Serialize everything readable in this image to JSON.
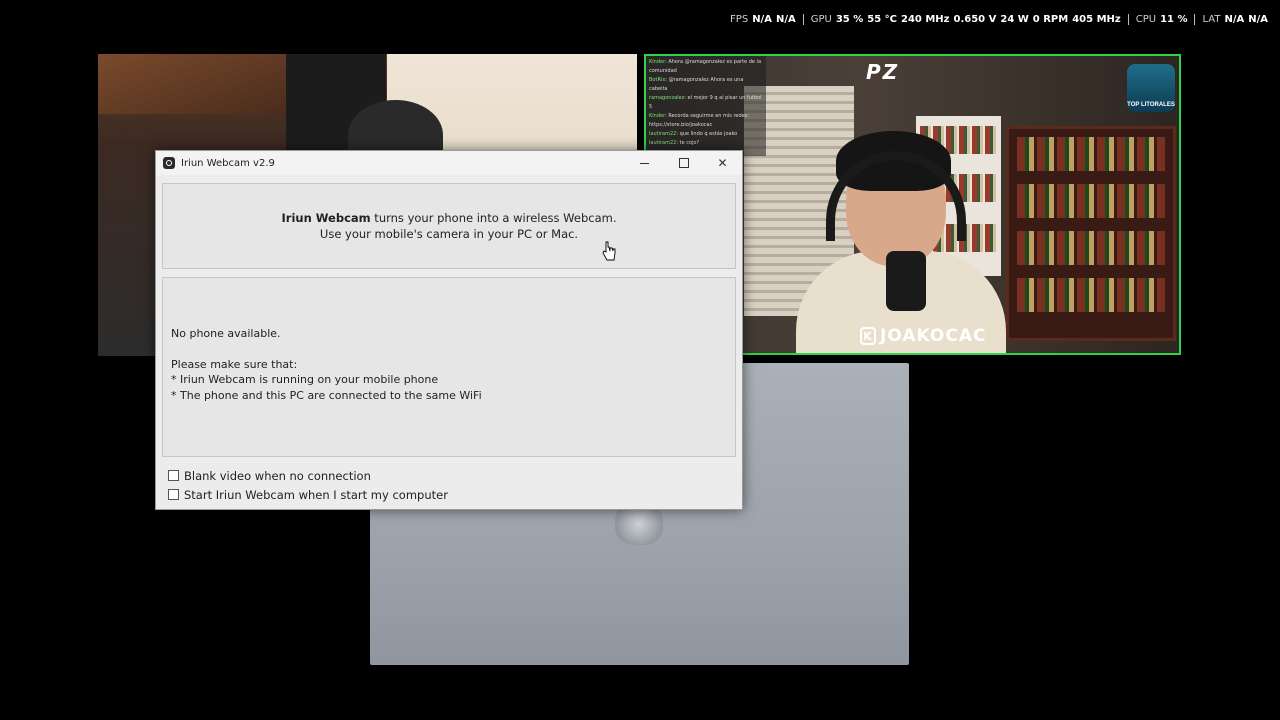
{
  "perf_overlay": [
    {
      "label": "FPS",
      "values": [
        "N/A",
        "N/A"
      ]
    },
    {
      "label": "GPU",
      "values": [
        "35 %",
        "55 °C",
        "240 MHz",
        "0.650 V",
        "24 W",
        "0 RPM",
        "405 MHz"
      ]
    },
    {
      "label": "CPU",
      "values": [
        "11 %"
      ]
    },
    {
      "label": "LAT",
      "values": [
        "N/A",
        "N/A"
      ]
    }
  ],
  "stream": {
    "streamer_name": "JOAKOCAC",
    "streamer_badge": "K",
    "logo_text": "PZ",
    "corner_logo": "TOP LITORALES",
    "accent_color": "#2ed34a",
    "chat": [
      {
        "user": "Kinder",
        "text": "Ahora @ramagonzalez es parte de la comunidad"
      },
      {
        "user": "BotRix",
        "text": "@ramagonzalez Ahora es una cabeita"
      },
      {
        "user": "ramagonzalez",
        "text": "el mejor 9 q ai pisar un futbol 5"
      },
      {
        "user": "Kinder",
        "text": "Recorda seguirme en mis redes: https://store.bio/joakocac"
      },
      {
        "user": "lautiram22",
        "text": "que lindo q estás joako"
      },
      {
        "user": "lautiram22",
        "text": "te cojo?"
      }
    ]
  },
  "window": {
    "title": "Iriun Webcam v2.9",
    "close_glyph": "✕",
    "header_brand": "Iriun Webcam",
    "header_line1_rest": " turns your phone into a wireless Webcam.",
    "header_line2": "Use your mobile's camera in your PC or Mac.",
    "status": "No phone available.",
    "instructions_title": "Please make sure that:",
    "instructions": [
      "* Iriun Webcam is running on your mobile phone",
      "* The phone and this PC are connected to the same WiFi"
    ],
    "options": [
      {
        "label": "Blank video when no connection",
        "checked": false
      },
      {
        "label": "Start Iriun Webcam when I start my computer",
        "checked": false
      }
    ]
  }
}
